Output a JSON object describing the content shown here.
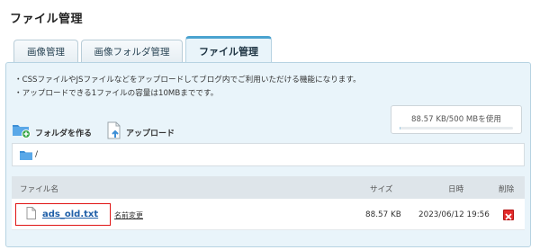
{
  "page": {
    "title": "ファイル管理"
  },
  "tabs": [
    {
      "label": "画像管理",
      "active": false
    },
    {
      "label": "画像フォルダ管理",
      "active": false
    },
    {
      "label": "ファイル管理",
      "active": true
    }
  ],
  "description": [
    "・CSSファイルやJSファイルなどをアップロードしてブログ内でご利用いただける機能になります。",
    "・アップロードできる1ファイルの容量は10MBまでです。"
  ],
  "actions": {
    "create_folder": {
      "label": "フォルダを作る",
      "icon": "folder-plus-icon"
    },
    "upload": {
      "label": "アップロード",
      "icon": "upload-file-icon"
    }
  },
  "quota": {
    "text": "88.57 KB/500 MBを使用",
    "used_fraction": 0.0002
  },
  "path": {
    "text": "/",
    "icon": "folder-icon"
  },
  "table": {
    "headers": {
      "name": "ファイル名",
      "size": "サイズ",
      "date": "日時",
      "delete": "削除"
    },
    "rows": [
      {
        "name": "ads_old.txt",
        "rename_label": "名前変更",
        "size": "88.57 KB",
        "date": "2023/06/12 19:56"
      }
    ]
  },
  "colors": {
    "accent": "#4ba3d0",
    "panel_bg": "#e9f4fa",
    "highlight": "#e01414",
    "delete": "#e32b2b",
    "link": "#1f5fa8"
  }
}
